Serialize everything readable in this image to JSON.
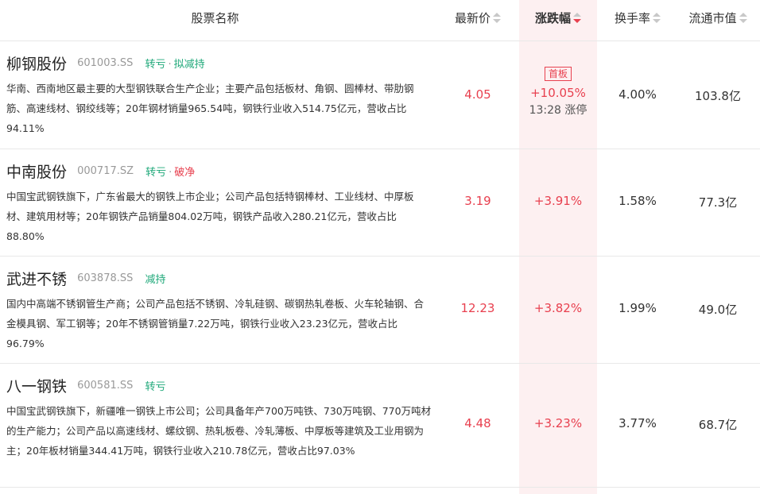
{
  "header": {
    "name": "股票名称",
    "price": "最新价",
    "change": "涨跌幅",
    "turnover": "换手率",
    "market_cap": "流通市值"
  },
  "colors": {
    "up": "#e8404f",
    "tag_green": "#1ea879",
    "sorted_bg": "#fdf0f1"
  },
  "rows": [
    {
      "name": "柳钢股份",
      "code": "601003.SS",
      "tag1": "转亏",
      "tag_sep": "·",
      "tag2": "拟减持",
      "desc": "华南、西南地区最主要的大型钢铁联合生产企业；主要产品包括板材、角钢、圆棒材、带肋钢筋、高速线材、钢绞线等；20年钢材销量965.54吨，钢铁行业收入514.75亿元，营收占比94.11%",
      "price": "4.05",
      "badge": "首板",
      "change": "+10.05%",
      "limit_time": "13:28 涨停",
      "turnover": "4.00%",
      "market_cap": "103.8亿"
    },
    {
      "name": "中南股份",
      "code": "000717.SZ",
      "tag1": "转亏",
      "tag_sep": "·",
      "tag2": "破净",
      "desc": "中国宝武钢铁旗下，广东省最大的钢铁上市企业；公司产品包括特钢棒材、工业线材、中厚板材、建筑用材等；20年钢铁产品销量804.02万吨，钢铁产品收入280.21亿元，营收占比88.80%",
      "price": "3.19",
      "change": "+3.91%",
      "turnover": "1.58%",
      "market_cap": "77.3亿"
    },
    {
      "name": "武进不锈",
      "code": "603878.SS",
      "tag1": "减持",
      "desc": "国内中高端不锈钢管生产商；公司产品包括不锈钢、冷轧硅钢、碳钢热轧卷板、火车轮轴钢、合金模具钢、军工钢等；20年不锈钢管销量7.22万吨，钢铁行业收入23.23亿元，营收占比96.79%",
      "price": "12.23",
      "change": "+3.82%",
      "turnover": "1.99%",
      "market_cap": "49.0亿"
    },
    {
      "name": "八一钢铁",
      "code": "600581.SS",
      "tag1": "转亏",
      "desc": "中国宝武钢铁旗下，新疆唯一钢铁上市公司；公司具备年产700万吨铁、730万吨钢、770万吨材的生产能力；公司产品以高速线材、螺纹钢、热轧板卷、冷轧薄板、中厚板等建筑及工业用钢为主；20年板材销量344.41万吨，钢铁行业收入210.78亿元，营收占比97.03%",
      "price": "4.48",
      "change": "+3.23%",
      "turnover": "3.77%",
      "market_cap": "68.7亿"
    }
  ]
}
